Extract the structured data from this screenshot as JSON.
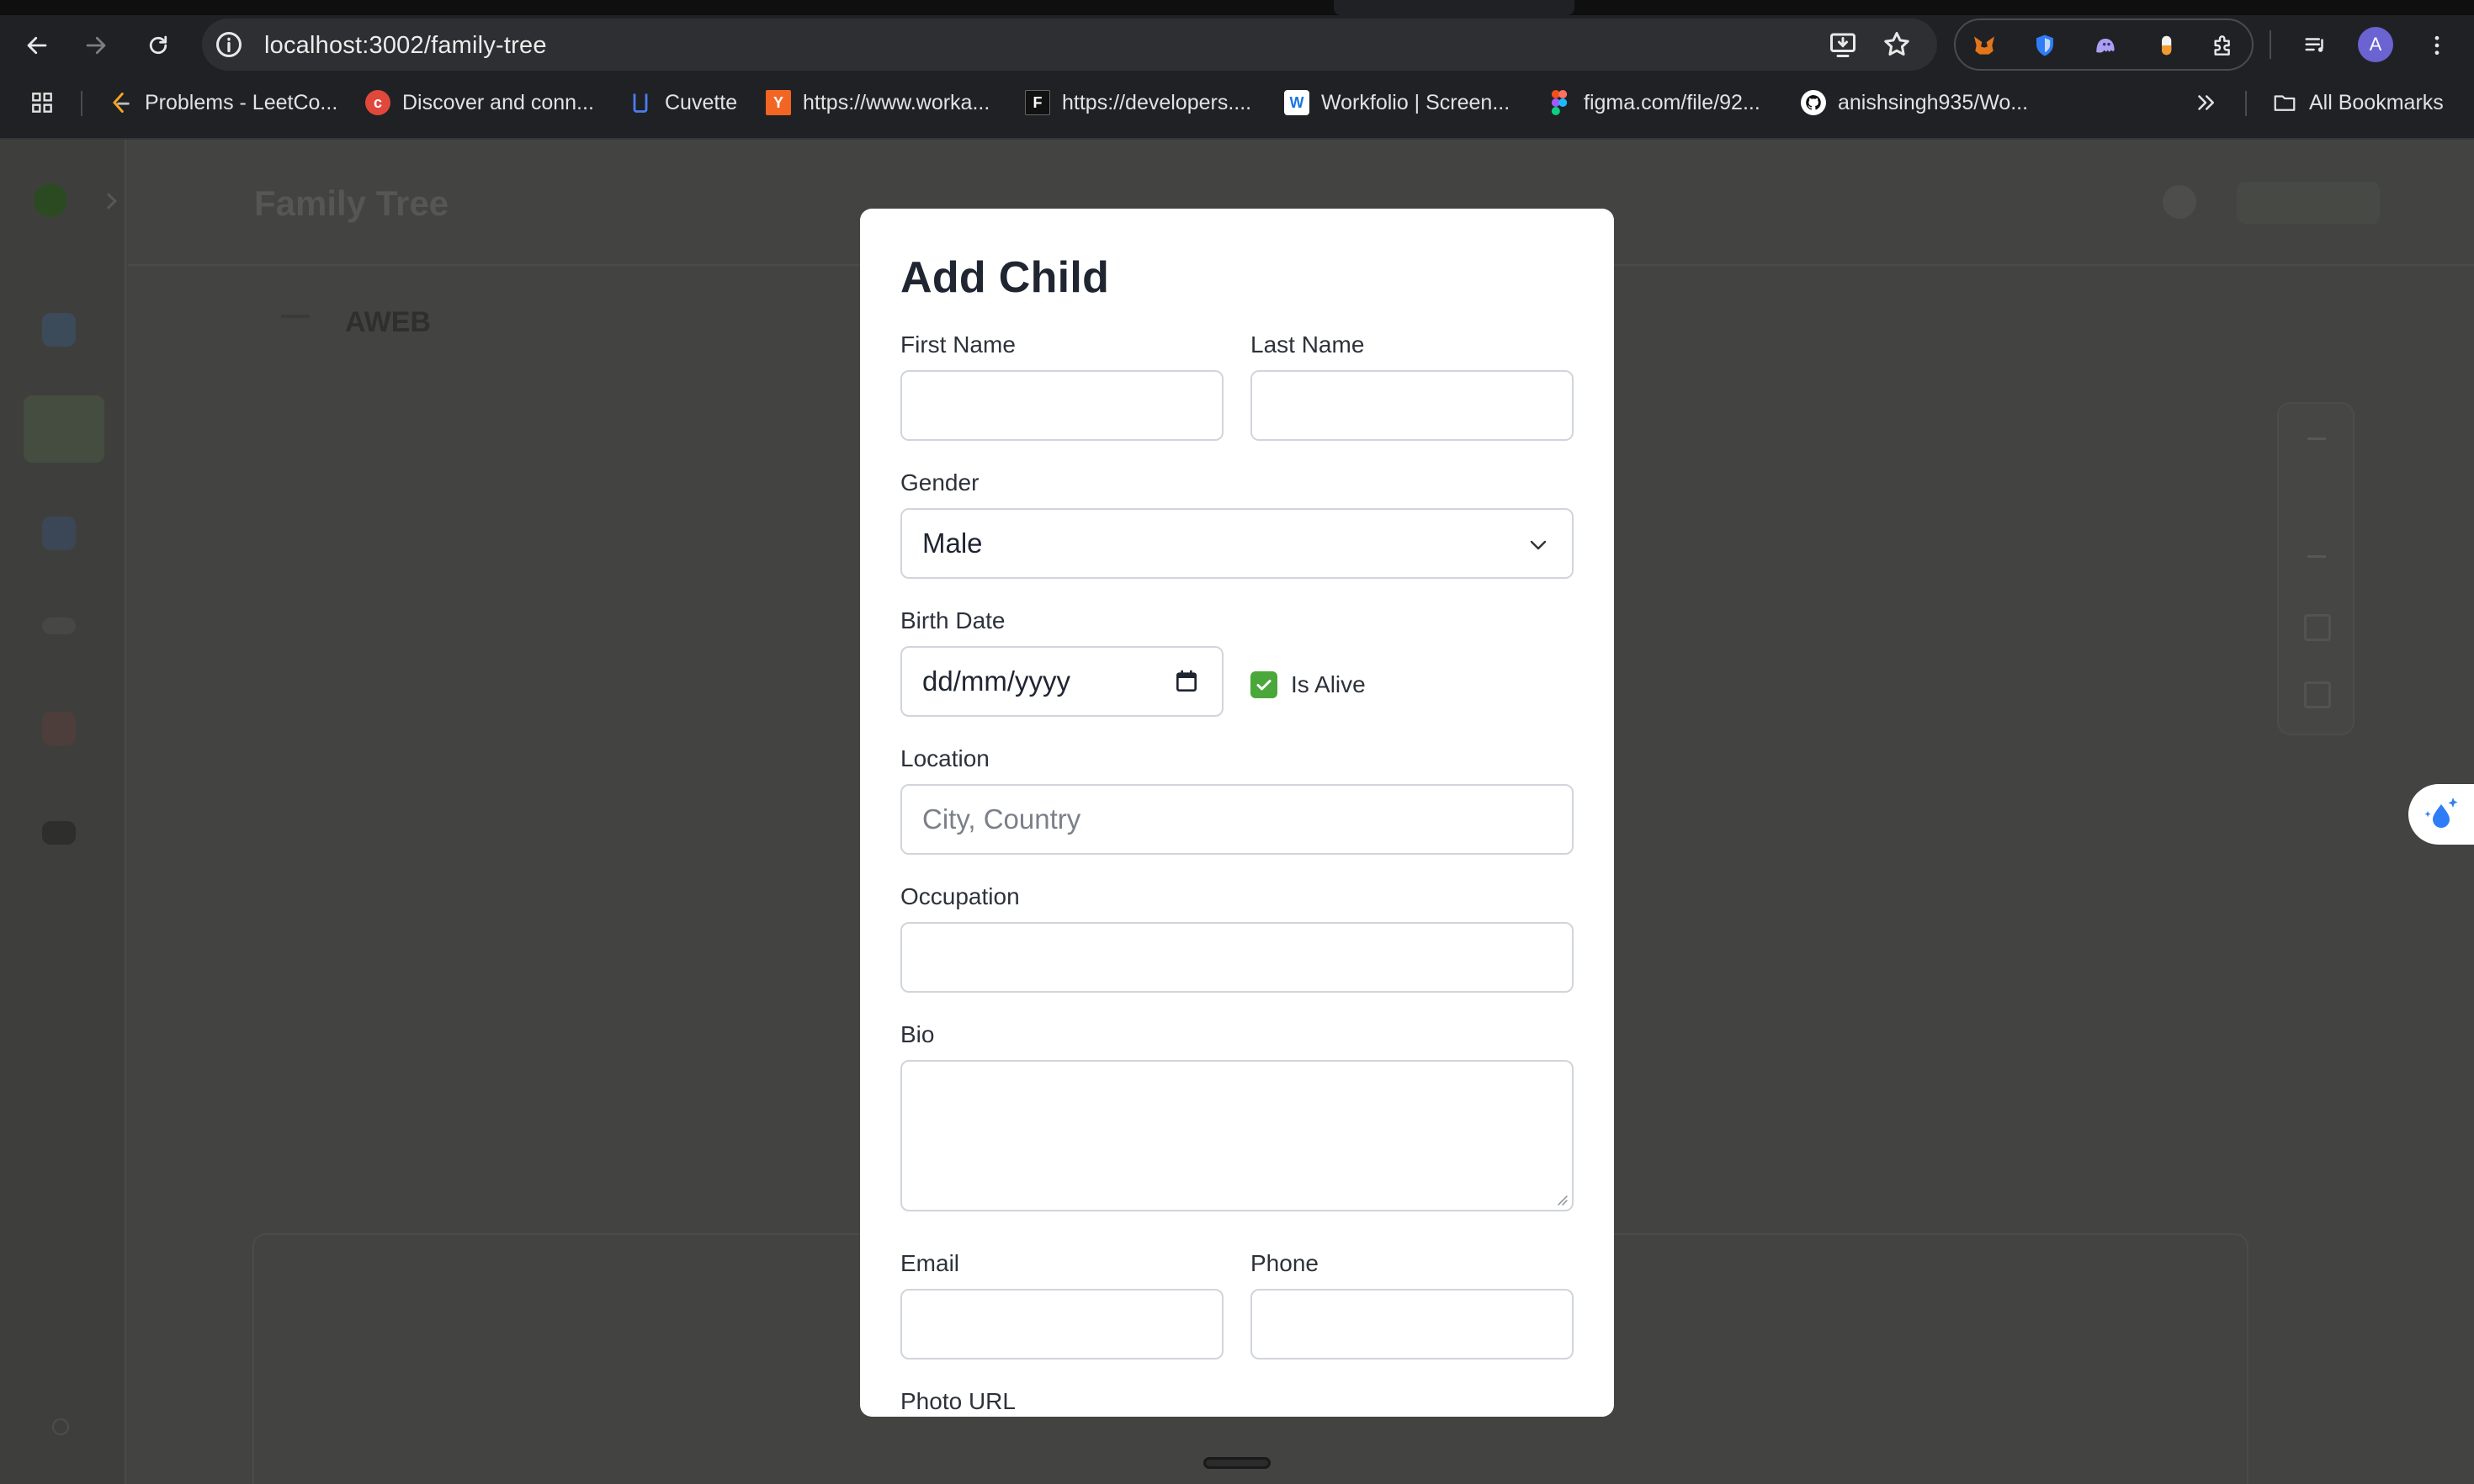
{
  "browser": {
    "url": "localhost:3002/family-tree",
    "avatar_initial": "A",
    "bookmarks": [
      {
        "label": "Problems - LeetCo...",
        "icon": "leetcode-icon",
        "color": "#f5a623"
      },
      {
        "label": "Discover and conn...",
        "icon": "c-logo-icon",
        "color": "#e0483c"
      },
      {
        "label": "Cuvette",
        "icon": "cuvette-icon",
        "color": "#4c7cf0"
      },
      {
        "label": "https://www.worka...",
        "icon": "y-logo-icon",
        "color": "#f26522"
      },
      {
        "label": "https://developers....",
        "icon": "f-logo-icon",
        "color": "#111111"
      },
      {
        "label": "Workfolio | Screen...",
        "icon": "workfolio-icon",
        "color": "#1a73e8"
      },
      {
        "label": "figma.com/file/92...",
        "icon": "figma-icon",
        "color": "#a259ff"
      },
      {
        "label": "anishsingh935/Wo...",
        "icon": "github-icon",
        "color": "#ffffff"
      }
    ],
    "all_bookmarks": "All Bookmarks"
  },
  "app": {
    "title": "Family Tree",
    "subtitle": "AWEB"
  },
  "modal": {
    "title": "Add Child",
    "first_name": {
      "label": "First Name",
      "value": "",
      "placeholder": ""
    },
    "last_name": {
      "label": "Last Name",
      "value": "",
      "placeholder": ""
    },
    "gender": {
      "label": "Gender",
      "selected": "Male"
    },
    "birth_date": {
      "label": "Birth Date",
      "placeholder": "dd/mm/yyyy"
    },
    "is_alive": {
      "label": "Is Alive",
      "checked": true
    },
    "location": {
      "label": "Location",
      "value": "",
      "placeholder": "City, Country"
    },
    "occupation": {
      "label": "Occupation",
      "value": "",
      "placeholder": ""
    },
    "bio": {
      "label": "Bio",
      "value": ""
    },
    "email": {
      "label": "Email",
      "value": "",
      "placeholder": ""
    },
    "phone": {
      "label": "Phone",
      "value": "",
      "placeholder": ""
    },
    "photo_url": {
      "label": "Photo URL"
    }
  },
  "colors": {
    "accent_check": "#4aa83a",
    "modal_bg": "#ffffff",
    "overlay": "#434442",
    "chrome": "#202124"
  }
}
